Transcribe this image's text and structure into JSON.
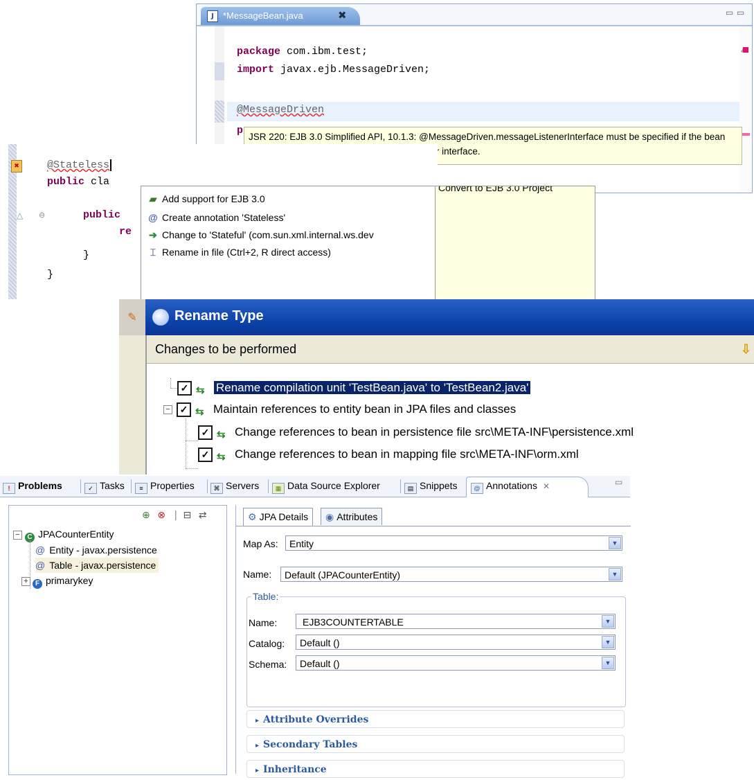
{
  "editor1": {
    "tab_title": "*MessageBean.java",
    "close_glyph": "✖",
    "win_min": "▭",
    "win_max": "▭",
    "line1_kw": "package",
    "line1_rest": " com.ibm.test;",
    "line2_kw": "import",
    "line2_rest": " javax.ejb.MessageDriven;",
    "line3": "@MessageDriven",
    "line4": "p",
    "line5": "}",
    "tooltip": "JSR 220: EJB 3.0 Simplified API, 10.1.3: @MessageDriven.messageListenerInterface must be specified if the bean class does not implement its message listener interface."
  },
  "editor2": {
    "l1": "@Stateless",
    "l2_kw": "public",
    "l2_rest": " cla",
    "l3_kw": "public",
    "l4": "re",
    "l5": "}",
    "l6": "}"
  },
  "quickfix": {
    "items": [
      {
        "icon": "ejb-project-icon",
        "label": "Add support for EJB 3.0"
      },
      {
        "icon": "annotation-icon",
        "label": "Create annotation 'Stateless'"
      },
      {
        "icon": "change-icon",
        "label": "Change to 'Stateful' (com.sun.xml.internal.ws.dev"
      },
      {
        "icon": "rename-icon",
        "label": "Rename in file (Ctrl+2, R direct access)"
      }
    ],
    "description": "Convert to EJB 3.0 Project"
  },
  "rename_dialog": {
    "title": "Rename Type",
    "header": "Changes to be performed",
    "rows": [
      {
        "label": "Rename compilation unit 'TestBean.java' to 'TestBean2.java'",
        "checked": true,
        "selected": true
      },
      {
        "label": "Maintain references to entity bean in JPA files and classes",
        "checked": true,
        "selected": false
      },
      {
        "label": "Change references to bean in persistence file src\\META-INF\\persistence.xml",
        "checked": true,
        "selected": false
      },
      {
        "label": "Change references to bean in mapping file src\\META-INF\\orm.xml",
        "checked": true,
        "selected": false
      }
    ]
  },
  "workbench": {
    "view_tabs": [
      "Problems",
      "Tasks",
      "Properties",
      "Servers",
      "Data Source Explorer",
      "Snippets",
      "Annotations"
    ],
    "active_tab": "Annotations",
    "tree": {
      "root": "JPACounterEntity",
      "children": [
        "Entity - javax.persistence",
        "Table - javax.persistence",
        "primarykey"
      ]
    },
    "detail_tabs": [
      "JPA Details",
      "Attributes"
    ],
    "map_as_label": "Map As:",
    "map_as_value": "Entity",
    "name_label": "Name:",
    "name_value": "Default (JPACounterEntity)",
    "table_group": "Table:",
    "table_name_label": "Name:",
    "table_name_value": "EJB3COUNTERTABLE",
    "catalog_label": "Catalog:",
    "catalog_value": "Default ()",
    "schema_label": "Schema:",
    "schema_value": "Default ()",
    "sections": [
      "Attribute Overrides",
      "Secondary Tables",
      "Inheritance"
    ]
  }
}
